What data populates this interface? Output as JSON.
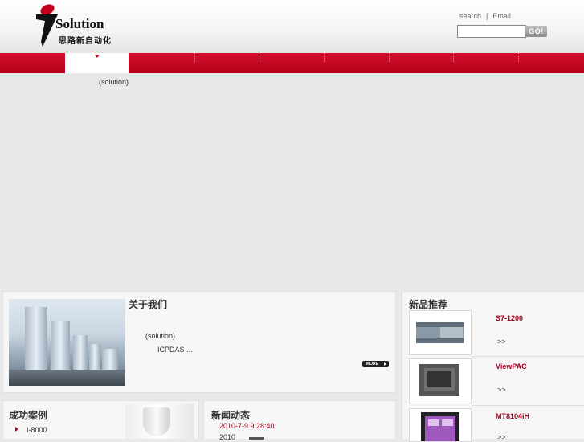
{
  "header": {
    "logo": {
      "brand": "Solution",
      "brand_cn": "思路新自动化"
    },
    "links": {
      "search": "search",
      "separator": "|",
      "email": "Email"
    },
    "search_input": {
      "value": "",
      "placeholder": ""
    },
    "go_label": "GO!"
  },
  "nav": {
    "active_index": 0
  },
  "banner": {
    "text": "(solution)"
  },
  "about": {
    "title": "关于我们",
    "text1": "(solution)",
    "text2": "ICPDAS      ...",
    "more_label": "MORE"
  },
  "products": {
    "title": "新品推荐",
    "items": [
      {
        "name": "S7-1200",
        "more": ">>"
      },
      {
        "name": "ViewPAC",
        "more": ">>"
      },
      {
        "name": "MT8104iH",
        "more": ">>"
      }
    ]
  },
  "cases": {
    "title": "成功案例",
    "items": [
      {
        "label": "I-8000"
      }
    ]
  },
  "news": {
    "title": "新闻动态",
    "time": "2010-7-9 9:28:40",
    "line": "2010"
  },
  "colors": {
    "accent_red": "#c0001d",
    "nav_red": "#c8102e"
  }
}
